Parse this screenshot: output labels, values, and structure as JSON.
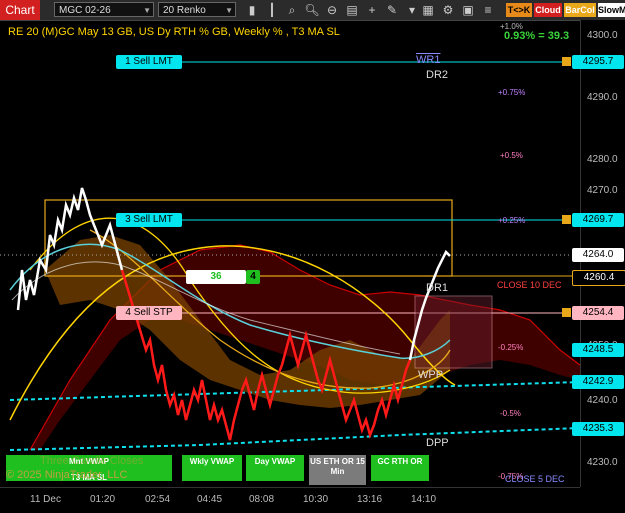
{
  "toolbar": {
    "chart_tab": "Chart",
    "instrument": "MGC 02-26",
    "bar_type": "20 Renko",
    "tk_label": "T<>K",
    "cloud_label": "Cloud",
    "barcol_label": "BarCol",
    "slow_label": "SlowM"
  },
  "header": {
    "indicator_text": "RE 20  (M)GC May 13 GB, US Dy RTH % GB, Weekly % , T3 MA SL",
    "stat_text": "0.93% = 39.3"
  },
  "orders": [
    {
      "label": "1 Sell LMT",
      "price": "4295.7"
    },
    {
      "label": "3 Sell LMT",
      "price": "4269.7"
    },
    {
      "label": "4 Sell STP",
      "price": "4254.4"
    }
  ],
  "qty_widget": {
    "quantity": "36",
    "count": "4"
  },
  "levels": {
    "wr1": "WR1",
    "dr2": "DR2",
    "dr1": "DR1",
    "wpp": "WPP",
    "dpp": "DPP",
    "pct_1": "+1.0%",
    "pct_075": "+0.75%",
    "pct_05": "+0.5%",
    "pct_025": "+0.25%",
    "pct_m025": "-0.25%",
    "pct_m05": "-0.5%",
    "pct_m075": "-0.75%",
    "close_10dec": "CLOSE 10 DEC",
    "close_5dec": "CLOSE 5 DEC"
  },
  "yaxis": {
    "ticks": [
      "4300.0",
      "4290.0",
      "4280.0",
      "4270.0",
      "4250.0",
      "4240.0",
      "4230.0"
    ],
    "current": "4264.0",
    "tag_4260": "4260.4",
    "tag_4248": "4248.5",
    "tag_4242": "4242.9",
    "tag_4235": "4235.3"
  },
  "xaxis": [
    "11 Dec",
    "01:20",
    "02:54",
    "04:45",
    "08:08",
    "10:30",
    "13:16",
    "14:10"
  ],
  "buttons": {
    "mkt_vwap": "Mnt VWAP",
    "wkly_vwap": "Wkly VWAP",
    "day_vwap": "Day VWAP",
    "us_eth_or": "US ETH OR 15 Min",
    "gc_rth_or": "GC RTH OR",
    "t3_ma_sl": "T3 MA SL"
  },
  "copyright": "© 2025 NinjaTrader, LLC",
  "watermark": "Three Candle Closes",
  "colors": {
    "sell_lmt": "#00e5ee",
    "sell_stp": "#ffb6c1",
    "cloud": "#5a0000",
    "accent_red": "#d21f1f"
  }
}
